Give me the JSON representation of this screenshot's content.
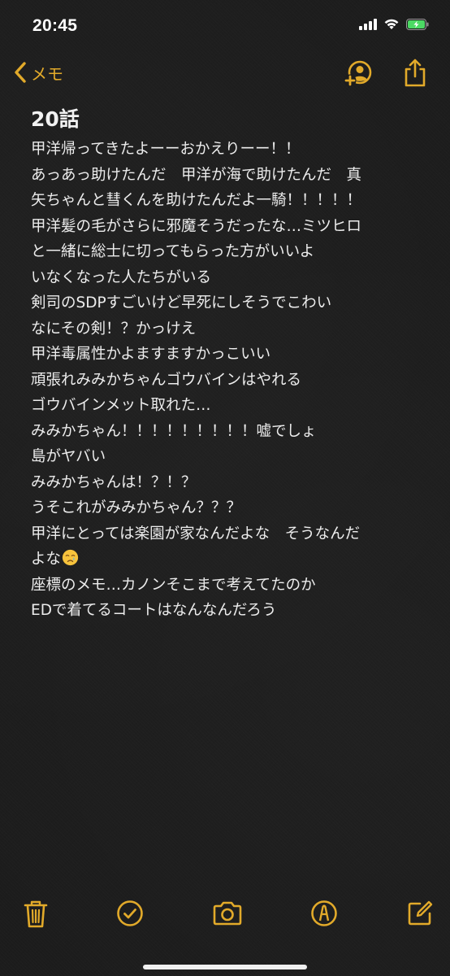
{
  "status_bar": {
    "time": "20:45",
    "icons": [
      "cellular-signal-icon",
      "wifi-icon",
      "battery-charging-icon"
    ]
  },
  "nav": {
    "back_label": "メモ",
    "back_icon": "chevron-left-icon",
    "share_collab_icon": "add-person-icon",
    "share_icon": "share-icon"
  },
  "note": {
    "title": "20話",
    "lines": [
      "甲洋帰ってきたよーーおかえりーー！！",
      "あっあっ助けたんだ　甲洋が海で助けたんだ　真",
      "矢ちゃんと彗くんを助けたんだよ一騎！！！！！",
      "甲洋髪の毛がさらに邪魔そうだったな…ミツヒロ",
      "と一緒に総士に切ってもらった方がいいよ",
      "いなくなった人たちがいる",
      "剣司のSDPすごいけど早死にしそうでこわい",
      "なにその剣！？かっけえ",
      "甲洋毒属性かよますますかっこいい",
      "頑張れみみかちゃんゴウバインはやれる",
      "ゴウバインメット取れた…",
      "みみかちゃん！！！！！！！！！嘘でしょ",
      "島がヤバい",
      "みみかちゃんは！？！？",
      "うそこれがみみかちゃん？？？",
      "甲洋にとっては楽園が家なんだよな　そうなんだ",
      "よな",
      "座標のメモ…カノンそこまで考えてたのか",
      "EDで着てるコートはなんなんだろう"
    ],
    "emoji_after_line_index": 16,
    "emoji": "crying-face-emoji"
  },
  "toolbar": {
    "items": [
      "trash-icon",
      "checklist-icon",
      "camera-icon",
      "markup-icon",
      "compose-icon"
    ]
  },
  "colors": {
    "accent": "#e2aa2a",
    "text": "#ececec",
    "background": "#1c1c1c",
    "battery_green": "#4cd964"
  }
}
